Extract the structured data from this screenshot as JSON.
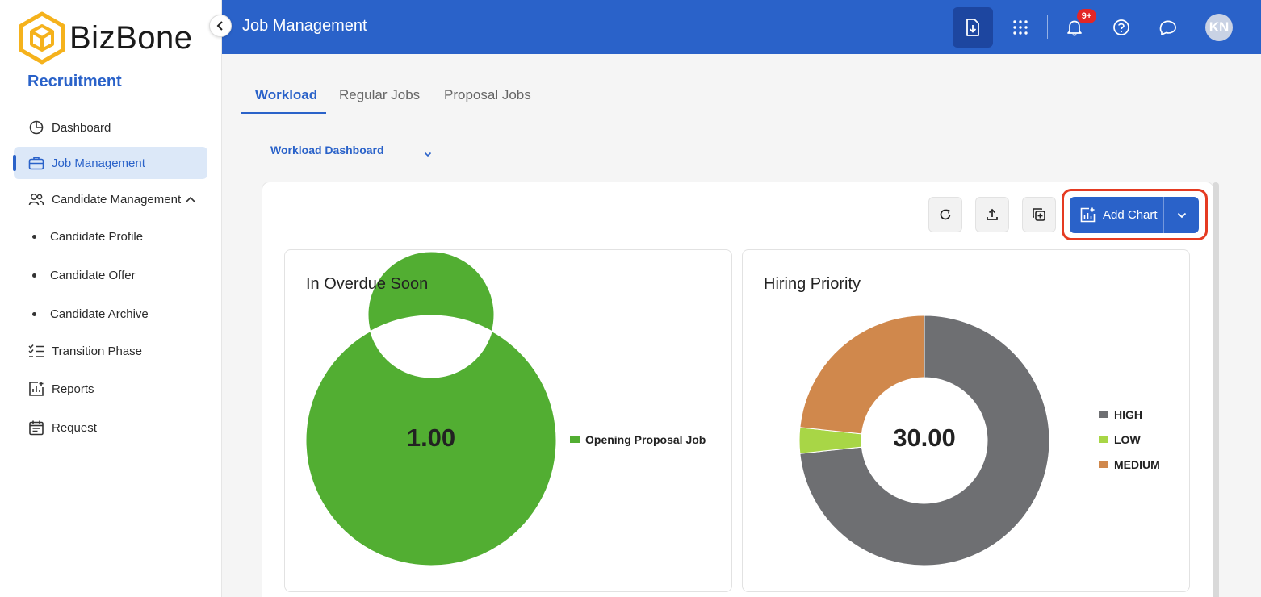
{
  "brand": {
    "name": "BizBone",
    "module": "Recruitment"
  },
  "sidebar": {
    "items": [
      {
        "label": "Dashboard"
      },
      {
        "label": "Job Management"
      },
      {
        "label": "Candidate Management"
      },
      {
        "label": "Candidate Profile"
      },
      {
        "label": "Candidate Offer"
      },
      {
        "label": "Candidate Archive"
      },
      {
        "label": "Transition Phase"
      },
      {
        "label": "Reports"
      },
      {
        "label": "Request"
      }
    ]
  },
  "header": {
    "title": "Job Management",
    "notification_badge": "9+",
    "avatar_initials": "KN"
  },
  "tabs": [
    {
      "label": "Workload"
    },
    {
      "label": "Regular Jobs"
    },
    {
      "label": "Proposal Jobs"
    }
  ],
  "dashboard_select": {
    "value": "Workload Dashboard"
  },
  "toolbar": {
    "add_chart_label": "Add Chart"
  },
  "colors": {
    "primary": "#2a62c9",
    "green": "#52ae32",
    "gray": "#6e6f72",
    "lime": "#a8d646",
    "orange": "#d0884c",
    "highlight": "#e53b22"
  },
  "chart_data": [
    {
      "type": "pie",
      "title": "In Overdue Soon",
      "center_label": "1.00",
      "categories": [
        "Opening Proposal Job"
      ],
      "values": [
        1
      ],
      "colors": [
        "#52ae32"
      ],
      "legend_position": "right"
    },
    {
      "type": "pie",
      "title": "Hiring Priority",
      "center_label": "30.00",
      "categories": [
        "HIGH",
        "LOW",
        "MEDIUM"
      ],
      "values": [
        22,
        1,
        7
      ],
      "colors": [
        "#6e6f72",
        "#a8d646",
        "#d0884c"
      ],
      "legend_position": "right"
    }
  ]
}
